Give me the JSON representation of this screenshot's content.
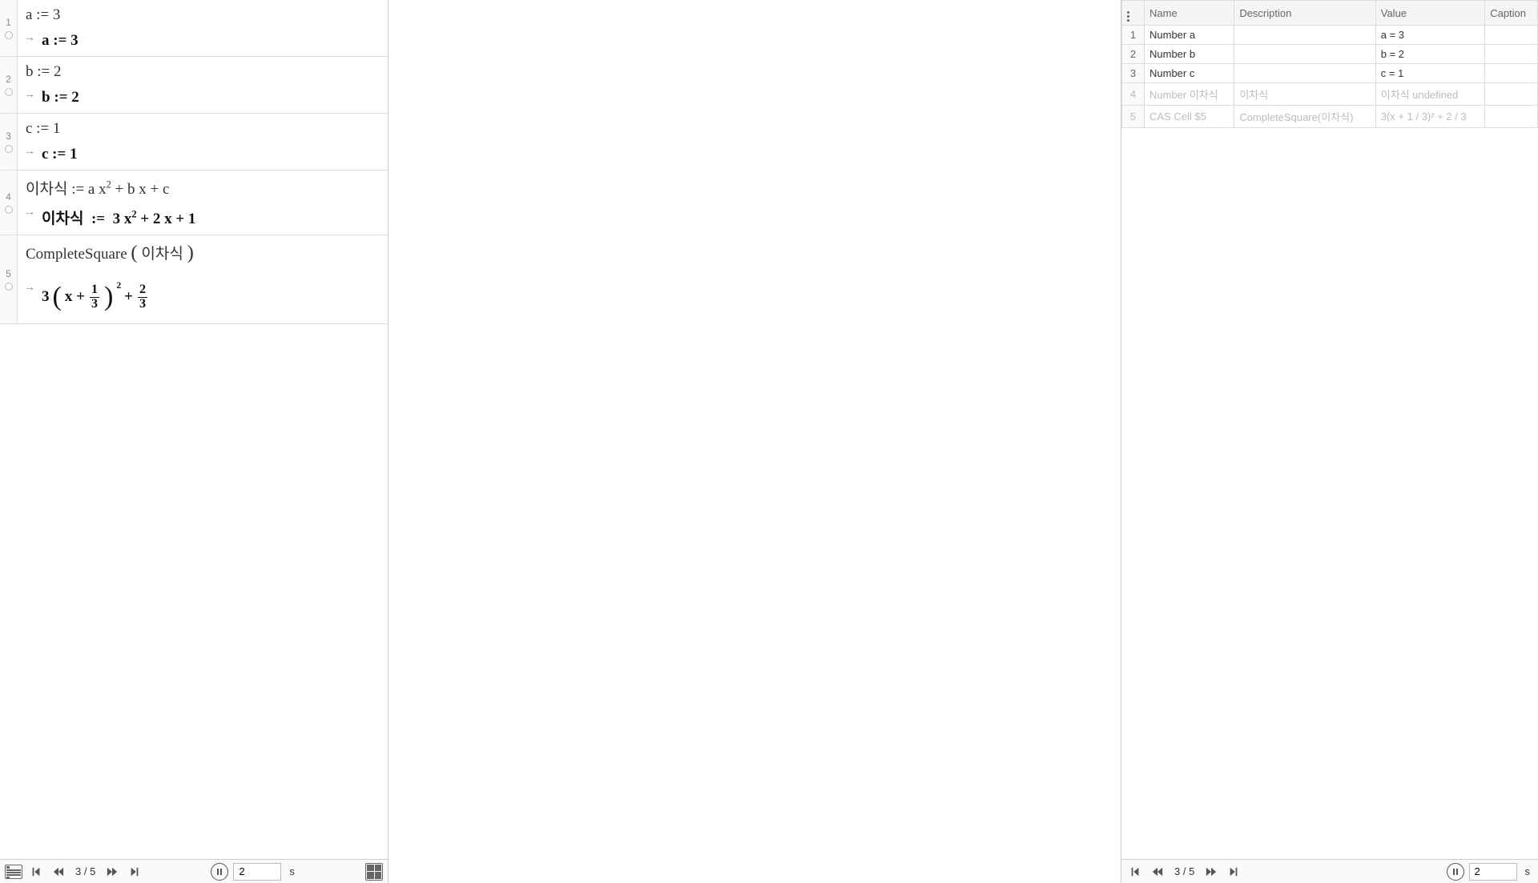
{
  "cas": {
    "rows": [
      {
        "num": "1",
        "input": "a := 3",
        "output": "a  :=  3"
      },
      {
        "num": "2",
        "input": "b := 2",
        "output": "b  :=  2"
      },
      {
        "num": "3",
        "input": "c := 1",
        "output": "c  :=  1"
      },
      {
        "num": "4",
        "input_html": "이차식 := a x<sup class='sup'>2</sup> + b x + c",
        "output_html": "이차식  :=  3 x<sup class='sup'>2</sup> + 2 x + 1"
      },
      {
        "num": "5",
        "input_html": "CompleteSquare ( 이차식 )",
        "output_special": true
      }
    ]
  },
  "controls_left": {
    "page": "3 / 5",
    "time_value": "2",
    "time_unit": "s"
  },
  "table": {
    "headers": [
      "Name",
      "Description",
      "Value",
      "Caption"
    ],
    "rows": [
      {
        "num": "1",
        "name": "Number a",
        "desc": "",
        "value": "a = 3",
        "caption": "",
        "dim": false
      },
      {
        "num": "2",
        "name": "Number b",
        "desc": "",
        "value": "b = 2",
        "caption": "",
        "dim": false
      },
      {
        "num": "3",
        "name": "Number c",
        "desc": "",
        "value": "c = 1",
        "caption": "",
        "dim": false
      },
      {
        "num": "4",
        "name": "Number 이차식",
        "desc": "이차식",
        "value": "이차식 undefined",
        "caption": "",
        "dim": true
      },
      {
        "num": "5",
        "name": "CAS Cell $5",
        "desc": "CompleteSquare(이차식)",
        "value": "3(x + 1 / 3)² + 2 / 3",
        "caption": "",
        "dim": true
      }
    ]
  },
  "controls_right": {
    "page": "3 / 5",
    "time_value": "2",
    "time_unit": "s"
  }
}
